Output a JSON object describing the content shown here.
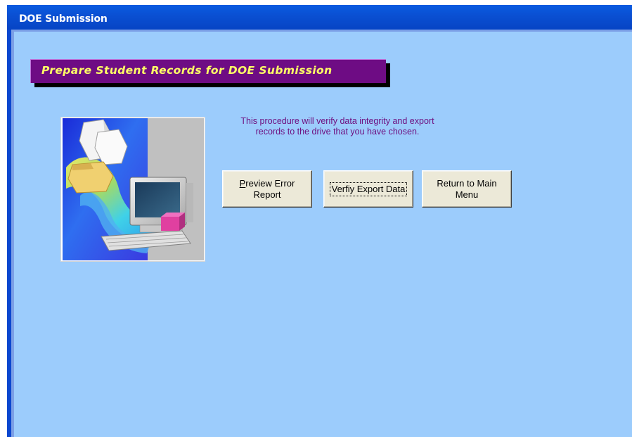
{
  "window": {
    "title": "DOE Submission"
  },
  "banner": {
    "title": "Prepare Student Records for DOE Submission"
  },
  "description": {
    "line1": "This procedure will verify data integrity and export",
    "line2": "records to the drive that you have chosen."
  },
  "buttons": {
    "preview": {
      "mnemonic": "P",
      "rest_line1": "review Error",
      "line2": "Report"
    },
    "verify": {
      "label": "Verfiy Export Data"
    },
    "return": {
      "line1": "Return to Main",
      "line2": "Menu"
    }
  },
  "colors": {
    "titlebar": "#0a4fd2",
    "client_background": "#9cccfc",
    "banner_background": "#6e0c84",
    "banner_text": "#ffff66",
    "description_text": "#6e1080",
    "button_face": "#ece9d8"
  },
  "icons": {
    "illustration": "computer-with-documents-clipart"
  }
}
